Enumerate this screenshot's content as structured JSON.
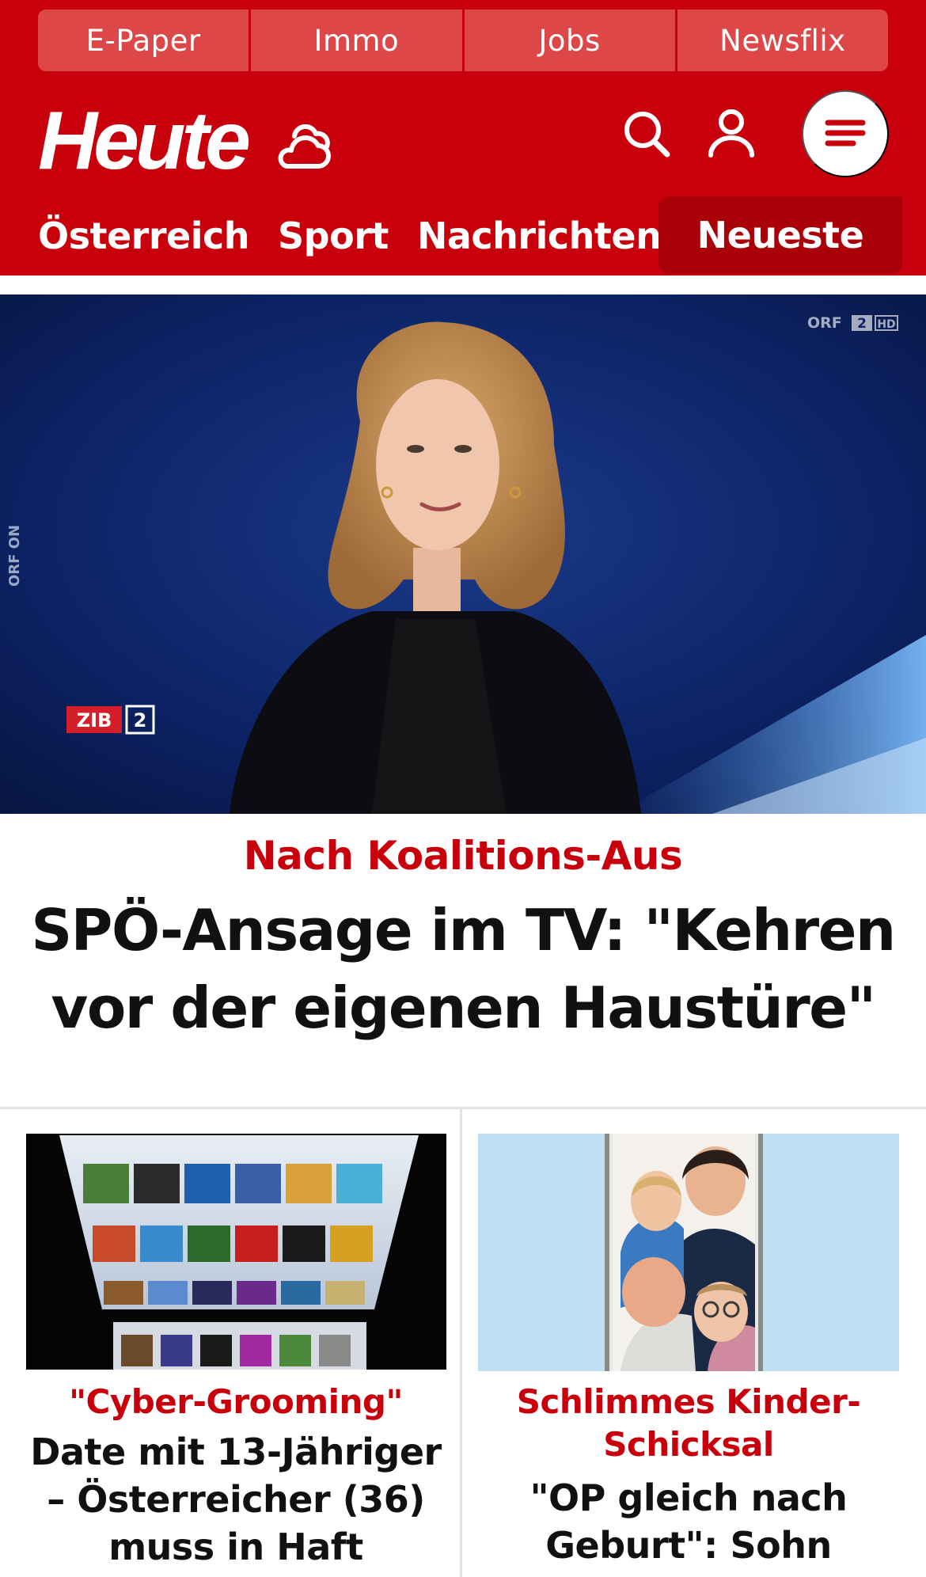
{
  "topbar": {
    "items": [
      {
        "label": "E-Paper"
      },
      {
        "label": "Immo"
      },
      {
        "label": "Jobs"
      },
      {
        "label": "Newsflix"
      }
    ]
  },
  "header": {
    "logo": "Heute",
    "icons": [
      "weather-cloud-icon",
      "search-icon",
      "user-icon",
      "menu-icon"
    ]
  },
  "nav": {
    "items": [
      {
        "label": "Österreich"
      },
      {
        "label": "Sport"
      },
      {
        "label": "Nachrichten"
      }
    ],
    "active": {
      "label": "Neueste"
    }
  },
  "hero": {
    "overlay": {
      "side_label": "ORF ON",
      "channel": "ORF",
      "channel_number": "2",
      "quality": "HD",
      "show": "ZIB",
      "show_number": "2"
    },
    "kicker": "Nach Koalitions-Aus",
    "headline": "SPÖ-Ansage im TV: \"Kehren vor der eigenen Haustüre\""
  },
  "cards": [
    {
      "kicker": "\"Cyber-Grooming\"",
      "headline": "Date mit 13-Jähriger – Österreicher (36) muss in Haft"
    },
    {
      "kicker": "Schlimmes Kinder-Schicksal",
      "headline": "\"OP gleich nach Geburt\": Sohn wurde"
    }
  ],
  "colors": {
    "brand_red": "#c8000b",
    "topbar_red": "#dd4747",
    "active_tab_red": "#a9000a",
    "text_dark": "#111111"
  }
}
